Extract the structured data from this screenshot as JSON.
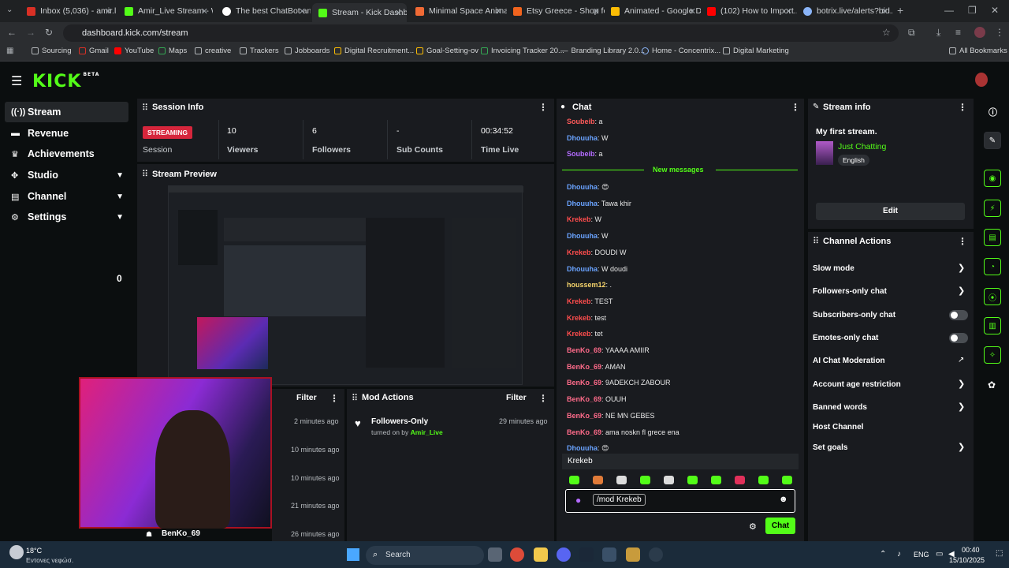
{
  "browser": {
    "tabs": [
      {
        "title": "Inbox (5,036) - amir.l...",
        "color": "#d93025"
      },
      {
        "title": "Amir_Live Stream - W...",
        "color": "#53fc18"
      },
      {
        "title": "The best ChatBot and...",
        "color": "#ffffff"
      },
      {
        "title": "Stream - Kick Dashbo...",
        "color": "#53fc18"
      },
      {
        "title": "Minimal Space Anima...",
        "color": "#f06a35"
      },
      {
        "title": "Etsy Greece - Shop fo...",
        "color": "#f1641e"
      },
      {
        "title": "Animated - Google D...",
        "color": "#fbbc04"
      },
      {
        "title": "(102) How to Import...",
        "color": "#ff0000"
      },
      {
        "title": "botrix.live/alerts?bid...",
        "color": "#8ab4f8"
      }
    ],
    "url": "dashboard.kick.com/stream",
    "bookmarks": [
      "Sourcing",
      "Gmail",
      "YouTube",
      "Maps",
      "creative",
      "Trackers",
      "Jobboards",
      "Digital Recruitment...",
      "Goal-Setting-ov",
      "Invoicing Tracker 20...",
      "Branding Library 2.0...",
      "Home - Concentrix...",
      "Digital Marketing"
    ],
    "all_bookmarks": "All Bookmarks"
  },
  "kick": {
    "logo": "KICK",
    "beta": "BETA"
  },
  "sidebar": {
    "items": [
      {
        "label": "Stream",
        "icon": "broadcast-icon"
      },
      {
        "label": "Revenue",
        "icon": "revenue-icon"
      },
      {
        "label": "Achievements",
        "icon": "trophy-icon"
      },
      {
        "label": "Studio",
        "icon": "studio-icon"
      },
      {
        "label": "Channel",
        "icon": "channel-icon"
      },
      {
        "label": "Settings",
        "icon": "gear-icon"
      }
    ],
    "counter": "0"
  },
  "session": {
    "title": "Session Info",
    "badge": "STREAMING",
    "session_label": "Session",
    "stats": [
      {
        "value": "10",
        "label": "Viewers"
      },
      {
        "value": "6",
        "label": "Followers"
      },
      {
        "value": "-",
        "label": "Sub Counts"
      },
      {
        "value": "00:34:52",
        "label": "Time Live"
      }
    ]
  },
  "preview": {
    "title": "Stream Preview"
  },
  "activity": {
    "filter": "Filter",
    "times": [
      "2 minutes ago",
      "10 minutes ago",
      "10 minutes ago",
      "21 minutes ago",
      "26 minutes ago"
    ],
    "last_user": "BenKo_69"
  },
  "mod_actions": {
    "title": "Mod Actions",
    "filter": "Filter",
    "item_title": "Followers-Only",
    "item_sub": "turned on by",
    "item_user": "Amir_Live",
    "item_time": "29 minutes ago"
  },
  "chat": {
    "title": "Chat",
    "new_messages": "New messages",
    "messages": [
      {
        "user": "Soubeib",
        "text": "a",
        "color": "#ff5a5a"
      },
      {
        "user": "Dhouuha",
        "text": "W",
        "color": "#6aa3ff"
      },
      {
        "user": "Soubeib",
        "text": "a",
        "color": "#b46bff"
      },
      {
        "user": "Dhouuha",
        "text": "😍",
        "color": "#6aa3ff"
      },
      {
        "user": "Dhouuha",
        "text": "Tawa khir",
        "color": "#6aa3ff"
      },
      {
        "user": "Krekeb",
        "text": "W",
        "color": "#ff4d4d"
      },
      {
        "user": "Dhouuha",
        "text": "W",
        "color": "#6aa3ff"
      },
      {
        "user": "Krekeb",
        "text": "DOUDI W",
        "color": "#ff4d4d"
      },
      {
        "user": "Dhouuha",
        "text": "W doudi",
        "color": "#6aa3ff"
      },
      {
        "user": "houssem12",
        "text": ".",
        "color": "#f5d36b"
      },
      {
        "user": "Krekeb",
        "text": "TEST",
        "color": "#ff4d4d"
      },
      {
        "user": "Krekeb",
        "text": "test",
        "color": "#ff4d4d"
      },
      {
        "user": "Krekeb",
        "text": "tet",
        "color": "#ff4d4d"
      },
      {
        "user": "BenKo_69",
        "text": "YAAAA AMIIR",
        "color": "#ff6b8a"
      },
      {
        "user": "BenKo_69",
        "text": "AMAN",
        "color": "#ff6b8a"
      },
      {
        "user": "BenKo_69",
        "text": "9ADEKCH ZABOUR",
        "color": "#ff6b8a"
      },
      {
        "user": "BenKo_69",
        "text": "OUUH",
        "color": "#ff6b8a"
      },
      {
        "user": "BenKo_69",
        "text": "NE MN GEBES",
        "color": "#ff6b8a"
      },
      {
        "user": "BenKo_69",
        "text": "ama noskn fl grece ena",
        "color": "#ff6b8a"
      },
      {
        "user": "Dhouuha",
        "text": "😍",
        "color": "#6aa3ff"
      }
    ],
    "suggestion": "Krekeb",
    "input_value": "/mod Krekeb",
    "send_label": "Chat"
  },
  "stream_info": {
    "title": "Stream info",
    "stream_title": "My first stream.",
    "category": "Just Chatting",
    "language": "English",
    "edit_label": "Edit"
  },
  "channel_actions": {
    "title": "Channel Actions",
    "items": [
      {
        "label": "Slow mode",
        "control": "arrow"
      },
      {
        "label": "Followers-only chat",
        "control": "arrow"
      },
      {
        "label": "Subscribers-only chat",
        "control": "toggle"
      },
      {
        "label": "Emotes-only chat",
        "control": "toggle"
      },
      {
        "label": "AI Chat Moderation",
        "control": "external"
      },
      {
        "label": "Account age restriction",
        "control": "arrow"
      },
      {
        "label": "Banned words",
        "control": "arrow"
      },
      {
        "label": "Host Channel",
        "control": "none"
      },
      {
        "label": "Set goals",
        "control": "arrow"
      }
    ]
  },
  "taskbar": {
    "weather_temp": "18°C",
    "weather_desc": "Εντονες νεφώσ.",
    "search": "Search",
    "lang": "ENG",
    "time": "00:40",
    "date": "15/10/2025"
  }
}
